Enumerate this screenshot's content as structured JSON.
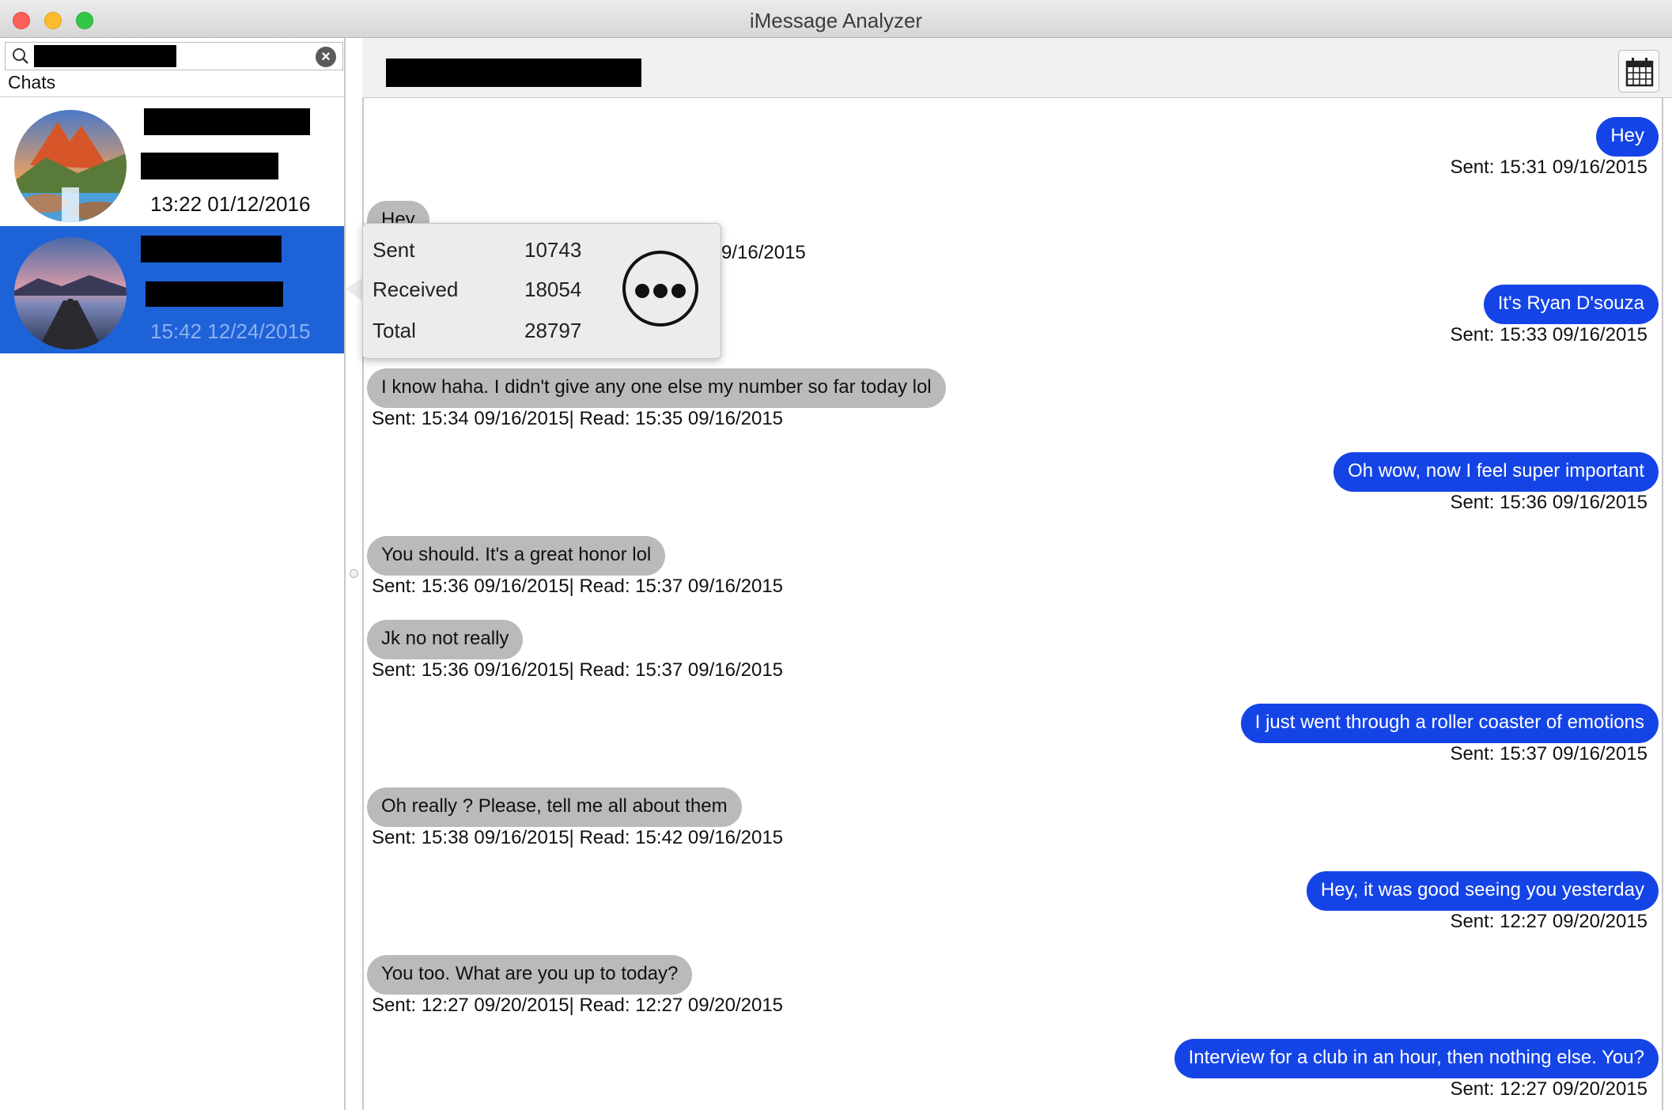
{
  "window": {
    "title": "iMessage Analyzer"
  },
  "sidebar": {
    "search": {
      "value": "",
      "placeholder": ""
    },
    "chats_label": "Chats",
    "chats": [
      {
        "time": "13:22 01/12/2016",
        "selected": false
      },
      {
        "time": "15:42 12/24/2015",
        "selected": true
      }
    ]
  },
  "popover": {
    "rows": [
      {
        "label": "Sent",
        "value": "10743"
      },
      {
        "label": "Received",
        "value": "18054"
      },
      {
        "label": "Total",
        "value": "28797"
      }
    ]
  },
  "messages": [
    {
      "direction": "out",
      "text": "Hey",
      "meta": "Sent: 15:31 09/16/2015"
    },
    {
      "direction": "in",
      "text": "Hey",
      "meta": "9/16/2015"
    },
    {
      "direction": "out",
      "text": "It's Ryan D'souza",
      "meta": "Sent: 15:33 09/16/2015"
    },
    {
      "direction": "in",
      "text": "I know haha. I didn't give any one else my number so far today lol",
      "meta": "Sent: 15:34 09/16/2015| Read: 15:35 09/16/2015"
    },
    {
      "direction": "out",
      "text": "Oh wow, now I feel super important",
      "meta": "Sent: 15:36 09/16/2015"
    },
    {
      "direction": "in",
      "text": "You should. It's a great honor lol",
      "meta": "Sent: 15:36 09/16/2015| Read: 15:37 09/16/2015"
    },
    {
      "direction": "in",
      "text": "Jk no not really",
      "meta": "Sent: 15:36 09/16/2015| Read: 15:37 09/16/2015"
    },
    {
      "direction": "out",
      "text": "I just went through a roller coaster of emotions",
      "meta": "Sent: 15:37 09/16/2015"
    },
    {
      "direction": "in",
      "text": "Oh really ? Please, tell me all about them",
      "meta": "Sent: 15:38 09/16/2015| Read: 15:42 09/16/2015"
    },
    {
      "direction": "out",
      "text": "Hey, it was good seeing you yesterday",
      "meta": "Sent: 12:27 09/20/2015"
    },
    {
      "direction": "in",
      "text": "You too. What are you up to today?",
      "meta": "Sent: 12:27 09/20/2015| Read: 12:27 09/20/2015"
    },
    {
      "direction": "out",
      "text": "Interview for a club in an hour, then nothing else. You?",
      "meta": "Sent: 12:27 09/20/2015"
    }
  ],
  "colors": {
    "outgoing_bubble": "#1544e6",
    "incoming_bubble": "#bababa",
    "selection": "#1e62d8"
  }
}
